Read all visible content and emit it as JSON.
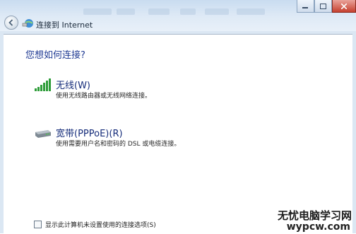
{
  "window": {
    "title": "连接到 Internet"
  },
  "content": {
    "question": "您想如何连接?",
    "options": [
      {
        "icon": "wireless-signal-icon",
        "label": "无线(W)",
        "description": "使用无线路由器或无线网络连接。"
      },
      {
        "icon": "broadband-modem-icon",
        "label": "宽带(PPPoE)(R)",
        "description": "使用需要用户名和密码的 DSL 或电缆连接。"
      }
    ],
    "footer_checkbox": {
      "label": "显示此计算机未设置使用的连接选项(S)",
      "checked": false
    }
  },
  "watermark": {
    "site_name": "无忧电脑学习网",
    "url": "wypcw.com"
  }
}
